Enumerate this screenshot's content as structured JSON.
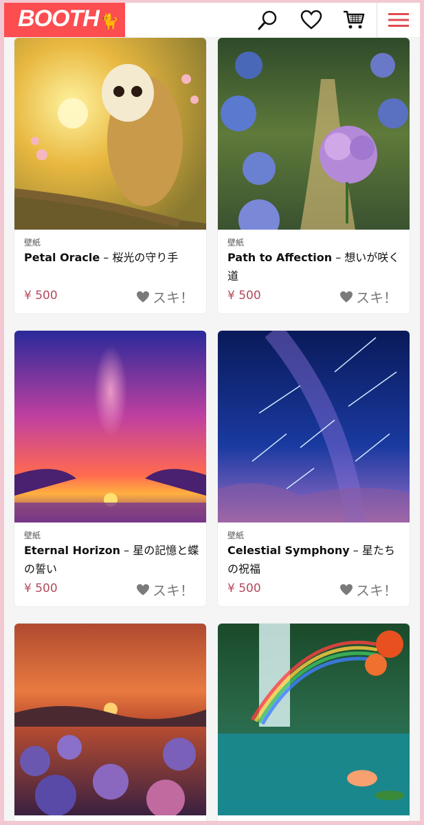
{
  "header": {
    "logo": "BOOTH",
    "icons": [
      "search-icon",
      "heart-icon",
      "cart-icon",
      "menu-icon"
    ]
  },
  "products": [
    {
      "category": "壁紙",
      "title_en": "Petal Oracle",
      "title_jp": " – 桜光の守り手",
      "price": "¥ 500",
      "like_label": "スキ！",
      "image": "owl-on-branch-in-golden-light"
    },
    {
      "category": "壁紙",
      "title_en": "Path to Affection",
      "title_jp": " – 想いが咲く道",
      "price": "¥ 500",
      "like_label": "スキ！",
      "image": "hydrangeas-along-forest-path"
    },
    {
      "category": "壁紙",
      "title_en": "Eternal Horizon",
      "title_jp": " – 星の記憶と蝶の誓い",
      "price": "¥ 500",
      "like_label": "スキ！",
      "image": "milky-way-over-sunset-sea"
    },
    {
      "category": "壁紙",
      "title_en": "Celestial Symphony",
      "title_jp": " – 星たちの祝福",
      "price": "¥ 500",
      "like_label": "スキ！",
      "image": "shooting-stars-night-sky"
    },
    {
      "image": "sunset-over-hydrangea-field"
    },
    {
      "image": "rainbow-waterfall-with-lotus"
    }
  ],
  "colors": {
    "brand": "#fc4d50",
    "price": "#b34a5c",
    "like": "#7a7a7a"
  }
}
